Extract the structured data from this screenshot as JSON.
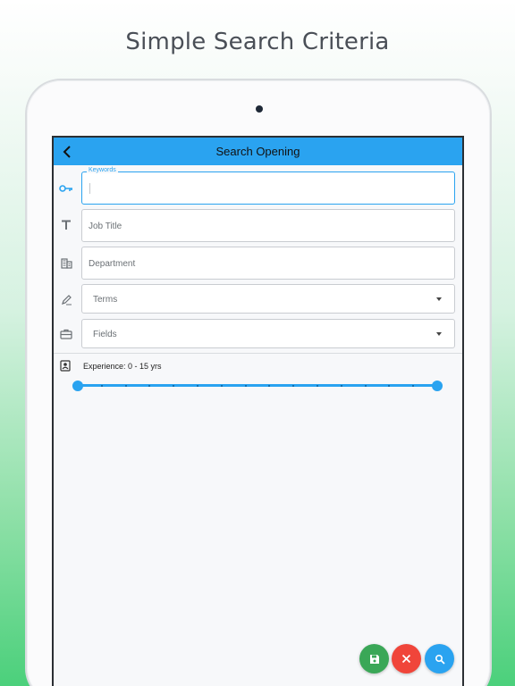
{
  "headline": "Simple Search Criteria",
  "appbar": {
    "title": "Search Opening",
    "back_icon": "arrow-back-icon"
  },
  "form": {
    "keywords": {
      "label": "Keywords",
      "value": "",
      "icon": "key-icon"
    },
    "job_title": {
      "placeholder": "Job Title",
      "icon": "text-icon"
    },
    "department": {
      "placeholder": "Department",
      "icon": "building-icon"
    },
    "terms": {
      "placeholder": "Terms",
      "icon": "pen-icon"
    },
    "fields": {
      "placeholder": "Fields",
      "icon": "briefcase-icon"
    }
  },
  "experience": {
    "label": "Experience: 0 - 15 yrs",
    "icon": "contact-card-icon",
    "range": {
      "min": 0,
      "max": 15,
      "low": 0,
      "high": 15
    }
  },
  "actions": {
    "save": {
      "icon": "save-icon",
      "color": "#3aa757"
    },
    "clear": {
      "icon": "close-icon",
      "color": "#f0453a"
    },
    "search": {
      "icon": "search-icon",
      "color": "#2aa3f0"
    }
  },
  "colors": {
    "accent": "#2aa3f0",
    "text": "#4a4f57"
  }
}
